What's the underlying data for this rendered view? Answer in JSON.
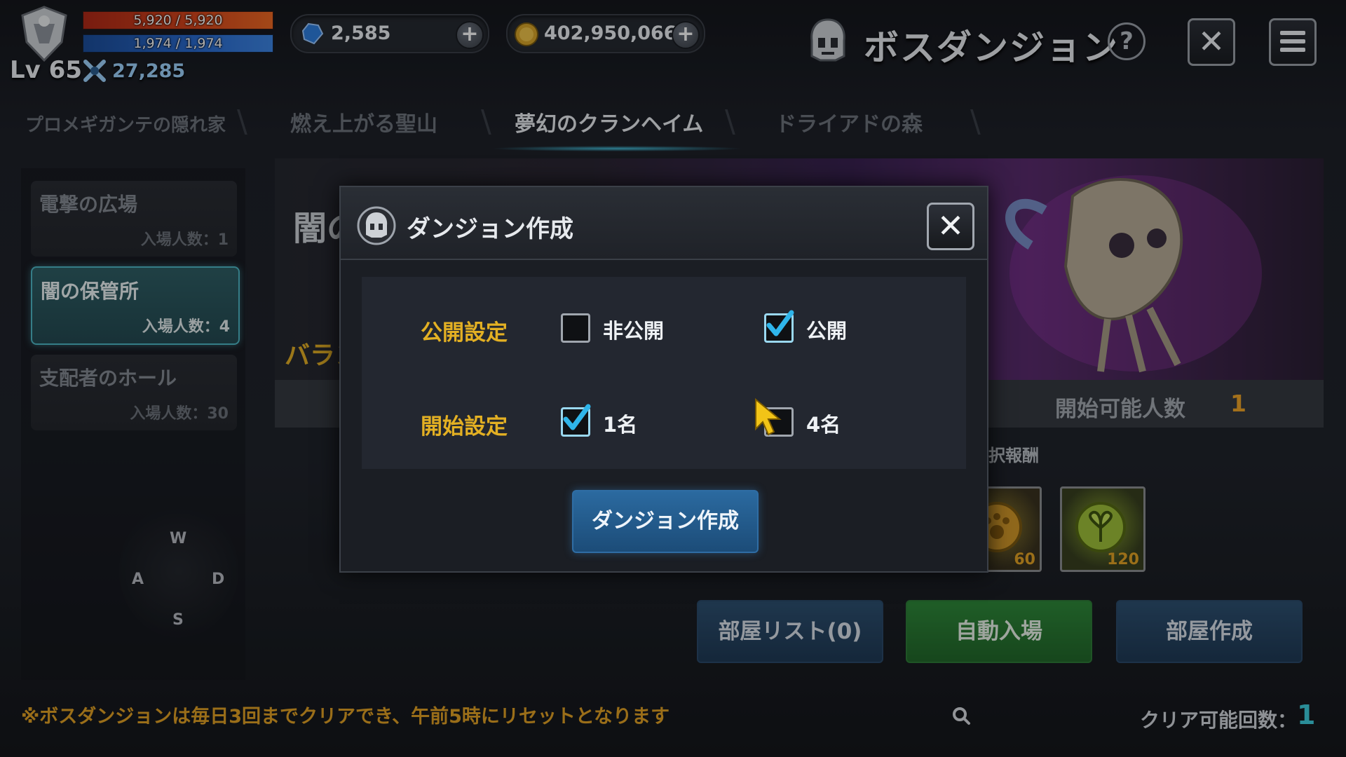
{
  "player": {
    "hp": "5,920 / 5,920",
    "mp": "1,974 / 1,974",
    "level": "Lv 65",
    "combat_power": "27,285"
  },
  "currency": {
    "gems": "2,585",
    "gold": "402,950,066"
  },
  "header": {
    "title": "ボスダンジョン",
    "help": "?"
  },
  "tabs": [
    {
      "label": "プロメギガンテの隠れ家"
    },
    {
      "label": "燃え上がる聖山"
    },
    {
      "label": "夢幻のクランヘイム"
    },
    {
      "label": "ドライアドの森"
    }
  ],
  "dungeons": [
    {
      "name": "電撃の広場",
      "count": "入場人数：1"
    },
    {
      "name": "闇の保管所",
      "count": "入場人数：4"
    },
    {
      "name": "支配者のホール",
      "count": "入場人数：30"
    }
  ],
  "joystick": {
    "up": "W",
    "left": "A",
    "right": "D",
    "down": "S"
  },
  "banner": {
    "title": "闇の",
    "subtitle": "バラン",
    "start_label": "開始可能人数",
    "start_value": "1",
    "reward_label": "択報酬",
    "rewards": [
      {
        "name": "paw-medal-icon",
        "qty": "60"
      },
      {
        "name": "leaf-medal-icon",
        "qty": "120"
      }
    ]
  },
  "actions": {
    "room_list": "部屋リスト(0)",
    "auto_enter": "自動入場",
    "create_room": "部屋作成"
  },
  "notice": "※ボスダンジョンは毎日3回までクリアでき、午前5時にリセットとなります",
  "clear": {
    "label": "クリア可能回数：",
    "value": "1"
  },
  "modal": {
    "title": "ダンジョン作成",
    "close": "✕",
    "visibility_label": "公開設定",
    "private_label": "非公開",
    "public_label": "公開",
    "private_checked": false,
    "public_checked": true,
    "start_label": "開始設定",
    "one_label": "1名",
    "four_label": "4名",
    "one_checked": true,
    "four_checked": false,
    "create_button": "ダンジョン作成"
  },
  "colors": {
    "accent_gold": "#e3b023",
    "accent_teal": "#4fb9c7",
    "check_blue": "#2fb5ea"
  }
}
